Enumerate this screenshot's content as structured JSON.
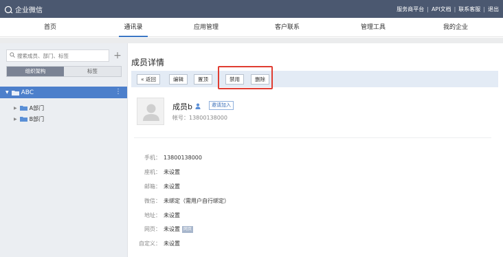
{
  "app": {
    "title": "企业微信",
    "top_links": [
      "服务商平台",
      "API文档",
      "联系客服",
      "退出"
    ]
  },
  "nav": {
    "tabs": [
      "首页",
      "通讯录",
      "应用管理",
      "客户联系",
      "管理工具",
      "我的企业"
    ],
    "active_index": 1
  },
  "sidebar": {
    "search_placeholder": "搜索成员、部门、标签",
    "seg_tabs": [
      "组织架构",
      "标签"
    ],
    "tree_root": "ABC",
    "tree_items": [
      "A部门",
      "B部门"
    ]
  },
  "main": {
    "title": "成员详情",
    "toolbar": {
      "back": "« 返回",
      "edit": "编辑",
      "top": "置顶",
      "disable": "禁用",
      "delete": "删除"
    },
    "member": {
      "name": "成员b",
      "invite": "邀请加入",
      "account": "帐号：13800138000"
    },
    "fields": [
      {
        "label": "手机：",
        "value": "13800138000"
      },
      {
        "label": "座机：",
        "value": "未设置"
      },
      {
        "label": "邮箱：",
        "value": "未设置"
      },
      {
        "label": "微信：",
        "value": "未绑定（需用户自行绑定）"
      },
      {
        "label": "地址：",
        "value": "未设置"
      },
      {
        "label": "网页：",
        "value": "未设置",
        "tag": "网页"
      },
      {
        "label": "自定义：",
        "value": "未设置"
      }
    ]
  },
  "colors": {
    "topbar": "#4b5870",
    "accent": "#4c7fcb",
    "highlight": "#e03c31"
  }
}
